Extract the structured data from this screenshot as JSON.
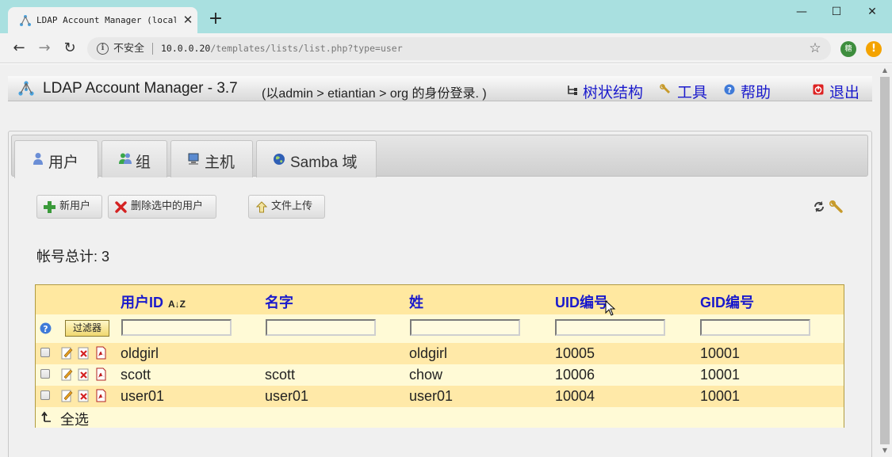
{
  "browser": {
    "tab_title": "LDAP Account Manager (localhost)",
    "close_glyph": "✕",
    "new_tab_glyph": "+",
    "window_controls": {
      "minimize": "—",
      "maximize": "☐",
      "close": "✕"
    },
    "nav": {
      "back": "←",
      "forward": "→",
      "reload": "↻"
    },
    "security_label": "不安全",
    "url_host": "10.0.0.20",
    "url_path": "/templates/lists/list.php?type=user",
    "bookmark_glyph": "☆",
    "extension_1": "糖",
    "extension_2": "!"
  },
  "header": {
    "app_title": "LDAP Account Manager - 3.7",
    "login_info": "(以admin > etiantian > org 的身份登录. )",
    "links": {
      "tree": "树状结构",
      "tools": "工具",
      "help": "帮助",
      "logout": "退出"
    }
  },
  "tabs": [
    {
      "label": "用户",
      "icon": "user-icon",
      "active": true
    },
    {
      "label": "组",
      "icon": "group-icon",
      "active": false
    },
    {
      "label": "主机",
      "icon": "host-icon",
      "active": false
    },
    {
      "label": "Samba 域",
      "icon": "globe-icon",
      "active": false
    }
  ],
  "toolbar": {
    "new_user": "新用户",
    "delete_selected": "删除选中的用户",
    "file_upload": "文件上传"
  },
  "account_total": "帐号总计: 3",
  "table": {
    "columns": [
      "用户ID",
      "名字",
      "姓",
      "UID编号",
      "GID编号"
    ],
    "sort_glyph": "A↓Z",
    "filter_button": "过滤器",
    "rows": [
      {
        "uid": "oldgirl",
        "given_name": "",
        "surname": "oldgirl",
        "uid_number": "10005",
        "gid_number": "10001"
      },
      {
        "uid": "scott",
        "given_name": "scott",
        "surname": "chow",
        "uid_number": "10006",
        "gid_number": "10001"
      },
      {
        "uid": "user01",
        "given_name": "user01",
        "surname": "user01",
        "uid_number": "10004",
        "gid_number": "10001"
      }
    ],
    "select_all": "全选"
  },
  "colors": {
    "titlebar": "#a9e0e0",
    "link_blue": "#1a1acc",
    "table_header_bg": "#ffe8a0",
    "table_row_alt_bg": "#fffad6",
    "table_row_bg": "#ffe9a8"
  }
}
